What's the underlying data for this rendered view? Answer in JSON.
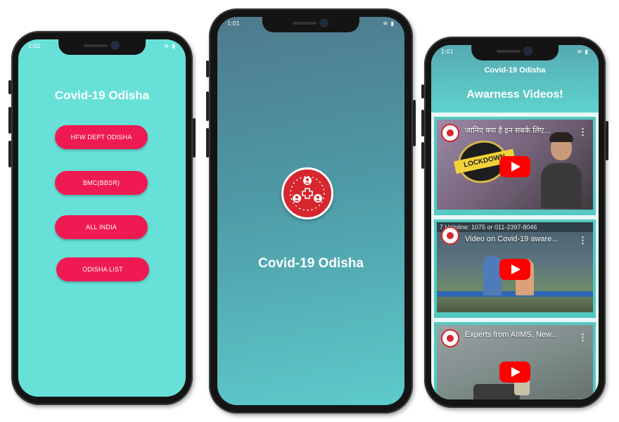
{
  "colors": {
    "teal": "#67e1d8",
    "accent_pink": "#f01a53",
    "logo_red": "#d7272e",
    "youtube_red": "#ff0000"
  },
  "phone1": {
    "status": {
      "time": "1:02",
      "icons": "≋ ▮"
    },
    "title": "Covid-19 Odisha",
    "buttons": [
      "HFW DEPT ODISHA",
      "BMC(BBSR)",
      "ALL INDIA",
      "ODISHA LIST"
    ]
  },
  "phone2": {
    "status": {
      "time": "1:01",
      "icons": "≋ ▮"
    },
    "logo_icon": "covid-care-logo-icon",
    "title": "Covid-19 Odisha"
  },
  "phone3": {
    "status": {
      "time": "1:01",
      "icons": "≋ ▮"
    },
    "app_name": "Covid-19 Odisha",
    "title": "Awarness Videos!",
    "videos": [
      {
        "title": "जानिए क्या है इन सबके लिए...",
        "overlay": "LOCKDOWN",
        "menu": "⋮"
      },
      {
        "title": "Video on Covid-19 aware...",
        "overlay": "7 Helpline: 1075 or 011-2397-8046",
        "menu": "⋮"
      },
      {
        "title": "Experts from AIIMS, New...",
        "overlay": "",
        "menu": "⋮"
      }
    ]
  }
}
